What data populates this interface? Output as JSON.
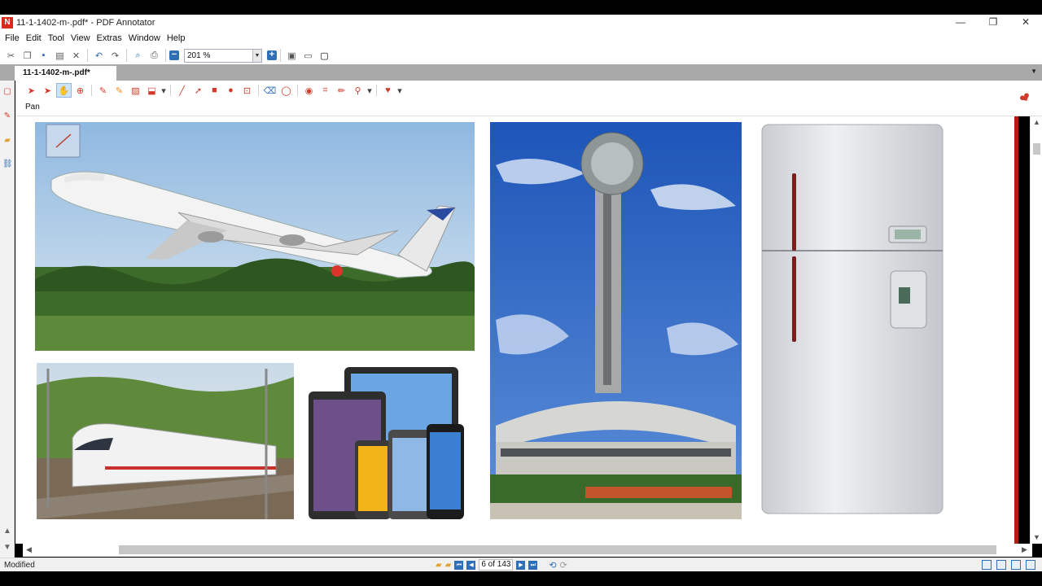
{
  "window": {
    "title": "11-1-1402-m-.pdf* - PDF Annotator",
    "logo_letter": "N",
    "minimize_glyph": "—",
    "restore_glyph": "❐",
    "close_glyph": "✕"
  },
  "menu": [
    "File",
    "Edit",
    "Tool",
    "View",
    "Extras",
    "Window",
    "Help"
  ],
  "toolbar": {
    "zoom_value": "201 %",
    "zoom_dropdown_glyph": "▼",
    "zoom_out_glyph": "−",
    "zoom_in_glyph": "+"
  },
  "document_tab": {
    "label": "11-1-1402-m-.pdf*",
    "dropdown_glyph": "▼"
  },
  "annotation_toolbar": {
    "current_tool_label": "Pan"
  },
  "status": {
    "left_text": "Modified",
    "page_indicator": "6 of 143"
  },
  "icons": {
    "cut": "✂",
    "copy": "❐",
    "save": "▪",
    "paste": "▤",
    "delete": "✕",
    "undo": "↶",
    "redo": "↷",
    "find": "⌕",
    "print": "⎙",
    "fit_page": "▣",
    "fit_width": "▭",
    "fullscreen": "▢",
    "select": "➤",
    "select_text": "➤",
    "pan": "✋",
    "zoom": "⊕",
    "pen": "✎",
    "marker": "✎",
    "image": "▨",
    "stamp": "⬓",
    "line": "╱",
    "arrow": "➚",
    "rectangle": "■",
    "ellipse": "●",
    "area": "⊡",
    "eraser": "⌫",
    "lasso": "◯",
    "camera": "◉",
    "crop": "⌗",
    "pencil": "✏",
    "link_tool": "⚲",
    "favorite": "♥",
    "dropdown": "▾",
    "bookmark_stamp": "❤",
    "left_page": "▢",
    "left_pen": "✎",
    "left_folder": "▰",
    "left_link": "⛓",
    "first": "⏮",
    "prev": "◀",
    "next": "▶",
    "last": "⏭",
    "back": "⟲",
    "forward": "⟳",
    "scroll_up": "▲",
    "scroll_down": "▼",
    "scroll_left": "◀",
    "scroll_right": "▶"
  },
  "images": [
    {
      "name": "airplane-photo",
      "subject": "airplane taking off"
    },
    {
      "name": "milad-tower-photo",
      "subject": "telecommunication tower"
    },
    {
      "name": "refrigerator-photo",
      "subject": "refrigerator"
    },
    {
      "name": "train-photo",
      "subject": "high-speed train"
    },
    {
      "name": "devices-photo",
      "subject": "tablets and smartphones"
    }
  ]
}
